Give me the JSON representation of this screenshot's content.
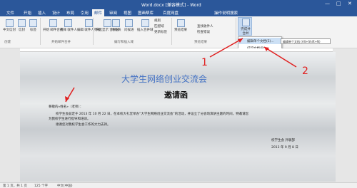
{
  "window": {
    "title": "Word.docx [兼容模式] - Word",
    "controls": [
      "—",
      "□",
      "✕"
    ]
  },
  "tabs": [
    "文件",
    "开始",
    "插入",
    "设计",
    "布局",
    "引用",
    "邮件",
    "审阅",
    "视图",
    "图画帮库",
    "百度网盘"
  ],
  "active_tab": "邮件",
  "tell_me": "操作说明搜索",
  "ribbon": {
    "buttons": [
      "中文信封",
      "信封",
      "标签",
      "开始\n邮件合并",
      "选择\n收件人",
      "编辑\n收件人列表",
      "突出显示\n合并域",
      "地址块",
      "问候语",
      "插入合并域",
      "规则",
      "匹配域",
      "更新标签",
      "预览结果",
      "查找收件人",
      "检查错误",
      "完成并合并"
    ],
    "groups": [
      "创建",
      "开始邮件合并",
      "编写和插入域",
      "预览结果",
      "完成"
    ]
  },
  "dropdown": {
    "items": [
      "编辑单个文档(E)...",
      "打印文档(P)...",
      "发送电子邮件(S)..."
    ],
    "tooltip": "编辑单个文档 (Alt+Shift+N)"
  },
  "document": {
    "title": "大学生网络创业交流会",
    "heading": "邀请函",
    "salutation": "尊敬的«姓名»（老师）：",
    "body1": "校学生会兹定于 2013 年 10 月 22 日，在本校大礼堂举办“大学生网络创业交流会”的活动，并设立了分会场演讲主题的时间，特邀请您",
    "body2": "为我校学生进行指导和培训。",
    "body3": "谢谢您对我校学生会工作的大力支持。",
    "sign1": "校学生会 外联部",
    "sign2": "2013 年 9 月 8 日"
  },
  "annotations": {
    "one": "1",
    "two": "2"
  },
  "status": {
    "page": "第 1 页，共 1 页",
    "words": "125 个字",
    "lang": "中文(中国)"
  }
}
